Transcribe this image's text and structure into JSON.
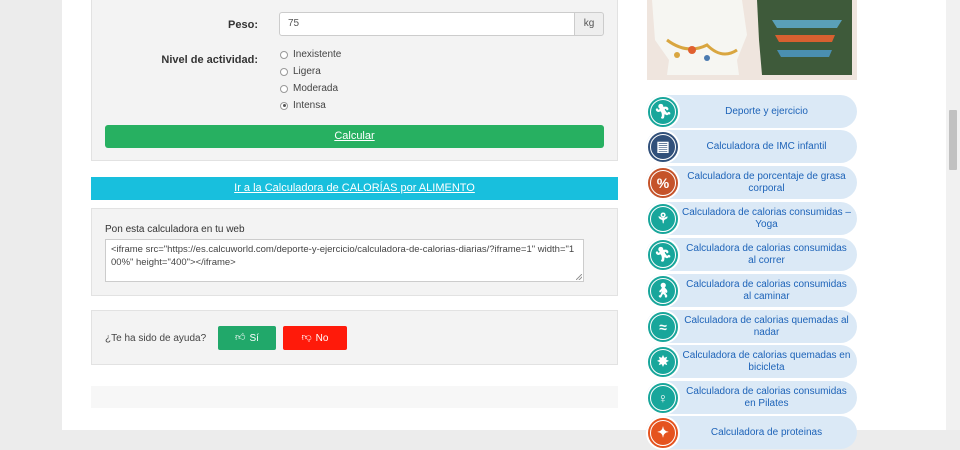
{
  "form": {
    "weight_label": "Peso:",
    "weight_value": "75",
    "weight_unit": "kg",
    "activity_label": "Nivel de actividad:",
    "activity_options": [
      "Inexistente",
      "Ligera",
      "Moderada",
      "Intensa"
    ],
    "activity_selected": "Intensa",
    "calculate_label": "Calcular"
  },
  "food_calculator_link": "Ir a la Calculadora de CALORÍAS por ALIMENTO",
  "embed": {
    "title": "Pon esta calculadora en tu web",
    "code": "<iframe src=\"https://es.calcuworld.com/deporte-y-ejercicio/calculadora-de-calorias-diarias/?iframe=1\" width=\"100%\" height=\"400\"></iframe>"
  },
  "feedback": {
    "question": "¿Te ha sido de ayuda?",
    "yes_label": "Sí",
    "no_label": "No"
  },
  "sidebar": {
    "items": [
      {
        "label": "Deporte y ejercicio",
        "icon": "runner-icon",
        "color": "#18a69b"
      },
      {
        "label": "Calculadora de IMC infantil",
        "icon": "scale-icon",
        "color": "#31507a"
      },
      {
        "label": "Calculadora de porcentaje de grasa corporal",
        "icon": "percent-icon",
        "color": "#c5532a"
      },
      {
        "label": "Calculadora de calorias consumidas – Yoga",
        "icon": "yoga-icon",
        "color": "#18a69b"
      },
      {
        "label": "Calculadora de calorias consumidas al correr",
        "icon": "runner-icon",
        "color": "#18a69b"
      },
      {
        "label": "Calculadora de calorias consumidas al caminar",
        "icon": "walker-icon",
        "color": "#18a69b"
      },
      {
        "label": "Calculadora de calorias quemadas al nadar",
        "icon": "swimmer-icon",
        "color": "#18a69b"
      },
      {
        "label": "Calculadora de calorias quemadas en bicicleta",
        "icon": "bicycle-wheel-icon",
        "color": "#18a69b"
      },
      {
        "label": "Calculadora de calorias consumidas en Pilates",
        "icon": "pilates-icon",
        "color": "#18a69b"
      },
      {
        "label": "Calculadora de proteinas",
        "icon": "protein-icon",
        "color": "#e5531f"
      }
    ]
  }
}
